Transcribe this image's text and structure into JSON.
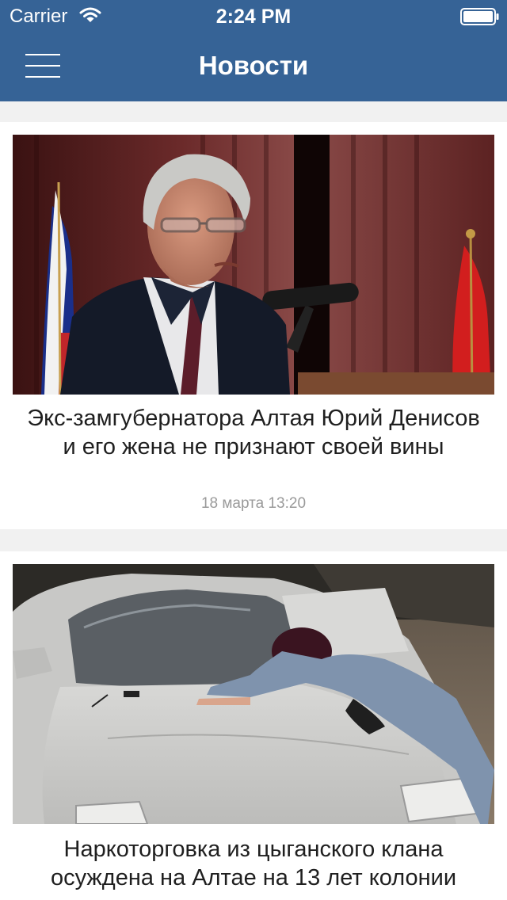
{
  "status_bar": {
    "carrier": "Carrier",
    "time": "2:24 PM",
    "wifi_icon": "wifi-icon",
    "battery_icon": "battery-icon"
  },
  "nav": {
    "title": "Новости",
    "menu_icon": "menu-icon"
  },
  "colors": {
    "nav_background": "#366396",
    "feed_background": "#f1f1f1",
    "card_background": "#ffffff",
    "date_text": "#9a9a9a"
  },
  "news": [
    {
      "title": "Экс-замгубернатора Алтая Юрий Денисов и его жена не признают своей вины",
      "date": "18 марта 13:20",
      "image": "photo-speaker-at-podium"
    },
    {
      "title": "Наркоторговка из цыганского клана осуждена на Алтае на 13 лет колонии",
      "image": "photo-woman-on-car-hood"
    }
  ]
}
